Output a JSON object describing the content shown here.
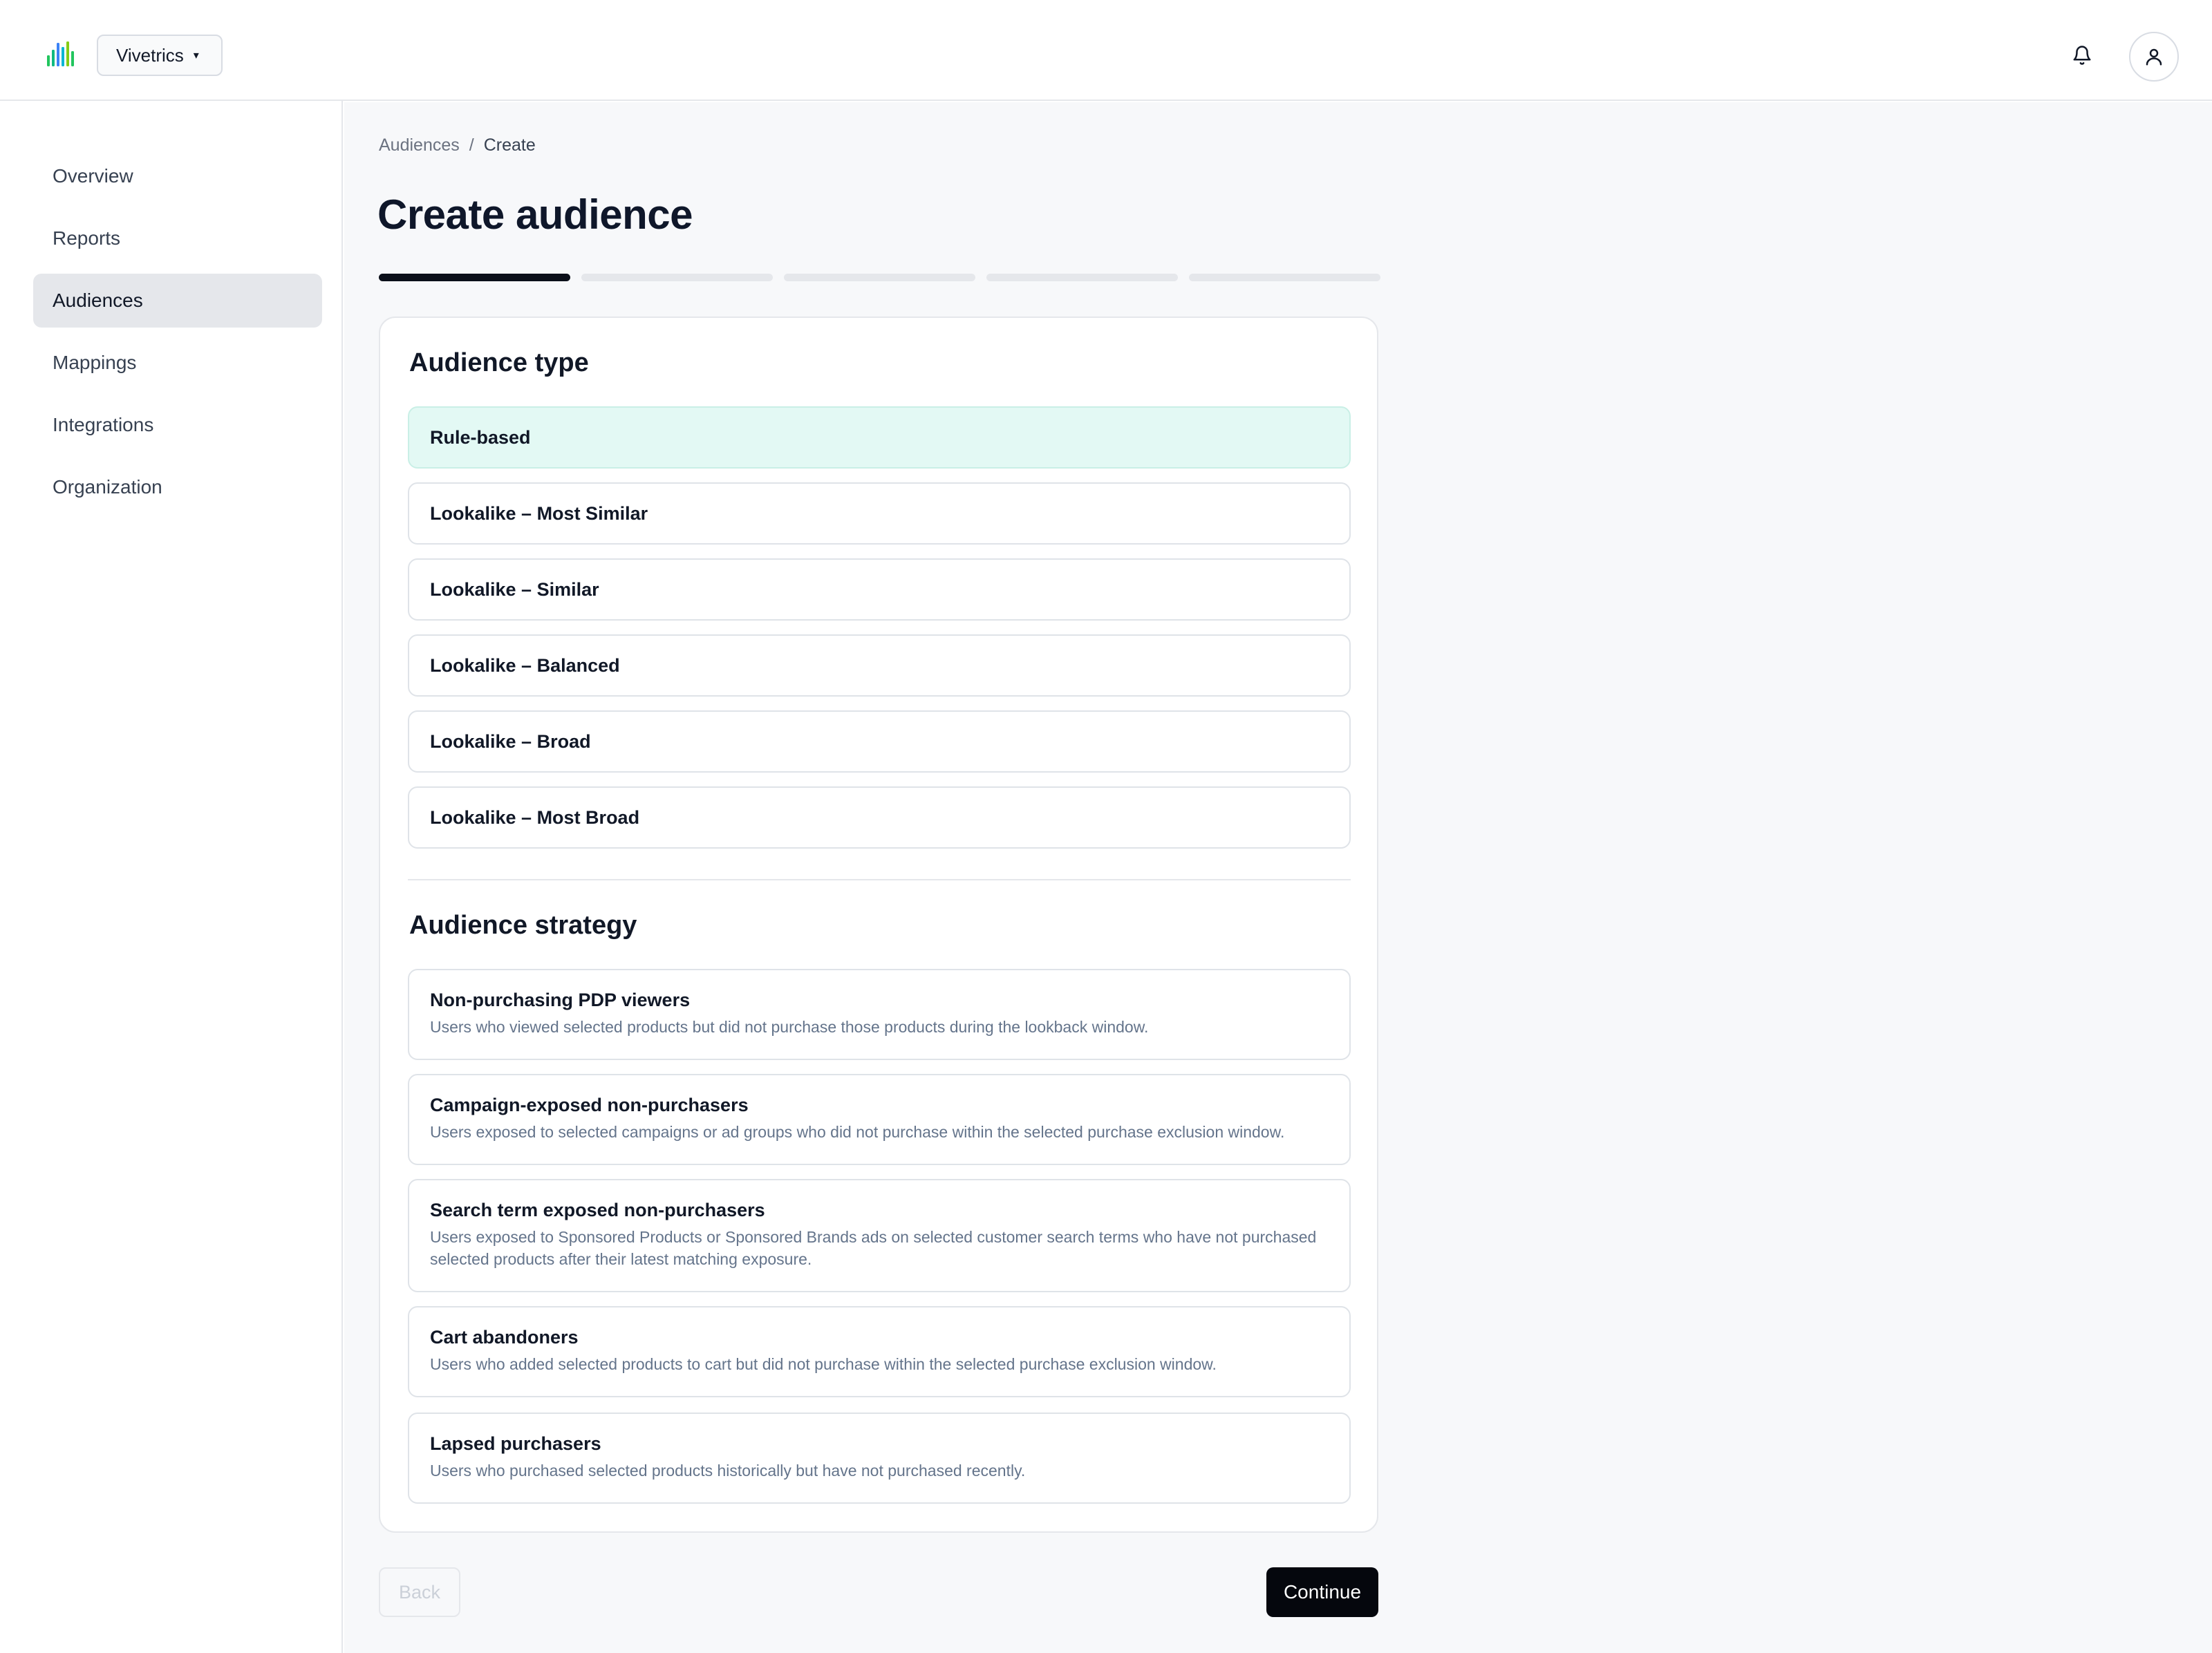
{
  "header": {
    "logo_icon": "bar-chart-logo-icon",
    "org_name": "Vivetrics",
    "org_caret": "▾",
    "bell_icon": "bell-icon",
    "user_icon": "user-icon"
  },
  "sidebar": {
    "items": [
      {
        "label": "Overview",
        "active": false
      },
      {
        "label": "Reports",
        "active": false
      },
      {
        "label": "Audiences",
        "active": true
      },
      {
        "label": "Mappings",
        "active": false
      },
      {
        "label": "Integrations",
        "active": false
      },
      {
        "label": "Organization",
        "active": false
      }
    ]
  },
  "breadcrumb": {
    "parent": "Audiences",
    "separator": "/",
    "current": "Create"
  },
  "page_title": "Create audience",
  "stepper": {
    "total_steps": 5,
    "current_step": 1
  },
  "audience_type": {
    "title": "Audience type",
    "selected": "Rule-based",
    "options": [
      "Rule-based",
      "Lookalike – Most Similar",
      "Lookalike – Similar",
      "Lookalike – Balanced",
      "Lookalike – Broad",
      "Lookalike – Most Broad"
    ]
  },
  "audience_strategy": {
    "title": "Audience strategy",
    "options": [
      {
        "title": "Non-purchasing PDP viewers",
        "description": "Users who viewed selected products but did not purchase those products during the lookback window."
      },
      {
        "title": "Campaign-exposed non-purchasers",
        "description": "Users exposed to selected campaigns or ad groups who did not purchase within the selected purchase exclusion window."
      },
      {
        "title": "Search term exposed non-purchasers",
        "description": "Users exposed to Sponsored Products or Sponsored Brands ads on selected customer search terms who have not purchased selected products after their latest matching exposure."
      },
      {
        "title": "Cart abandoners",
        "description": "Users who added selected products to cart but did not purchase within the selected purchase exclusion window."
      },
      {
        "title": "Lapsed purchasers",
        "description": "Users who purchased selected products historically but have not purchased recently."
      }
    ]
  },
  "footer": {
    "back_label": "Back",
    "continue_label": "Continue"
  },
  "colors": {
    "selected_option_bg": "#e3f9f4",
    "primary_button": "#05070d",
    "progress_active": "#0b0f19"
  }
}
